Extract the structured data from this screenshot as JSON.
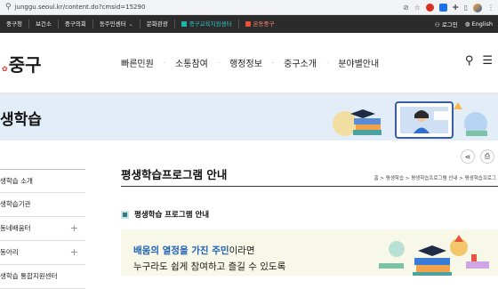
{
  "browser": {
    "url": "junggu.seoul.kr/content.do?cmsid=15290"
  },
  "top_nav": {
    "items": [
      "중구청",
      "보건소",
      "중구의회",
      "동주민센터",
      "문화관광",
      "중구교육지원센터",
      "온동중구"
    ],
    "login_label": "로그인",
    "language_label": "English"
  },
  "header": {
    "logo_text": "중구",
    "nav": [
      "빠른민원",
      "소통참여",
      "행정정보",
      "중구소개",
      "분야별안내"
    ]
  },
  "banner": {
    "title": "생학습"
  },
  "sidebar": {
    "items": [
      {
        "label": "생학습 소개",
        "expandable": false
      },
      {
        "label": "생학습기관",
        "expandable": false
      },
      {
        "label": "동네배움터",
        "expandable": true
      },
      {
        "label": "동아리",
        "expandable": true
      },
      {
        "label": "생학습 통합지원센터",
        "expandable": false
      }
    ]
  },
  "content": {
    "page_title": "평생학습프로그램 안내",
    "breadcrumb": "홈 > 평생학습 > 평생학습프로그램 안내 > 평생학습프로그",
    "section_heading": "평생학습 프로그램 안내",
    "intro_highlight": "배움의 열정을 가진 주민",
    "intro_line1_rest": "이라면",
    "intro_line2": "누구라도 쉽게 참여하고 즐길 수 있도록"
  },
  "colors": {
    "top_nav_bg": "#2b2b2b",
    "banner_bg": "#e3edf8",
    "highlight_blue": "#1e5fb8",
    "intro_bg": "#f7f8e8"
  }
}
